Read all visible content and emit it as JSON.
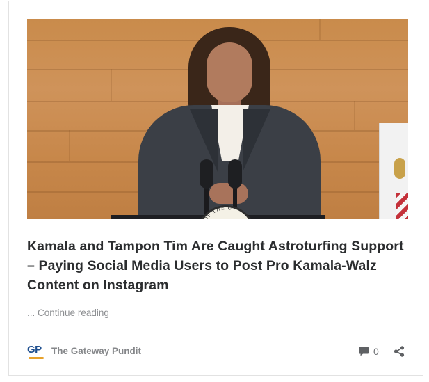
{
  "post": {
    "title": "Kamala and Tampon Tim Are Caught Astroturfing Support – Paying Social Media Users to Post Pro Kamala-Walz Content on Instagram",
    "excerpt_ellipsis": "...",
    "continue_label": "Continue reading",
    "image_alt": "Woman speaking at a podium in front of a wooden wall and flag",
    "seal_text": "OF THE U"
  },
  "footer": {
    "brand_logo_text": "GP",
    "brand_name": "The Gateway Pundit",
    "comment_count": "0",
    "icons": {
      "comment": "comment-icon",
      "share": "share-icon"
    }
  },
  "colors": {
    "title": "#2b2d2f",
    "muted": "#8d8f92",
    "logo_blue": "#1e4f8f",
    "logo_orange": "#e7a12a"
  }
}
